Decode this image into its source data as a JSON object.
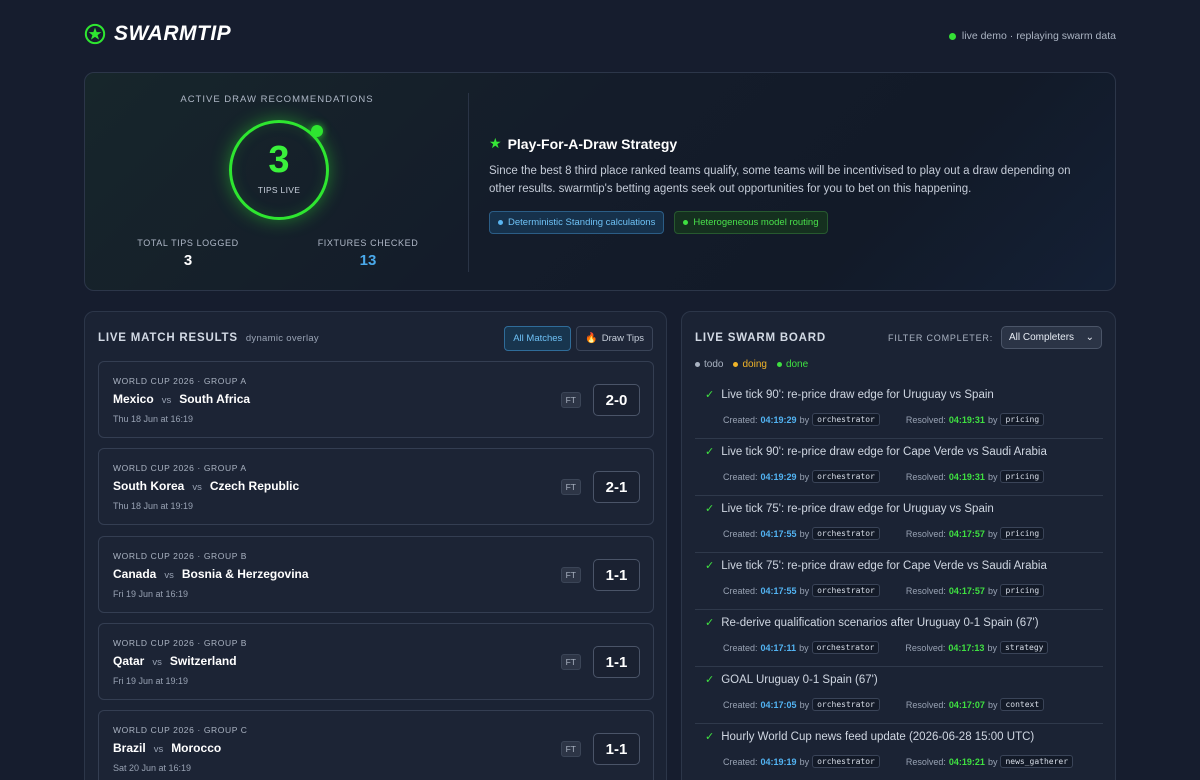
{
  "header": {
    "brand": "SWARMTIP",
    "live_status": "live demo · replaying swarm data"
  },
  "hero": {
    "active_label": "ACTIVE DRAW RECOMMENDATIONS",
    "tips_live_value": "3",
    "tips_live_label": "TIPS LIVE",
    "total_tips_label": "TOTAL TIPS LOGGED",
    "total_tips_value": "3",
    "fixtures_label": "FIXTURES CHECKED",
    "fixtures_value": "13",
    "strategy_title": "Play-For-A-Draw Strategy",
    "strategy_desc": "Since the best 8 third place ranked teams qualify, some teams will be incentivised to play out a draw depending on other results. swarmtip's betting agents seek out opportunities for you to bet on this happening.",
    "chip_1": "Deterministic Standing calculations",
    "chip_2": "Heterogeneous model routing"
  },
  "results": {
    "title": "LIVE MATCH RESULTS",
    "subtitle": "dynamic overlay",
    "tab_all": "All Matches",
    "tab_draw": "Draw Tips",
    "matches": [
      {
        "group": "WORLD CUP 2026 · GROUP A",
        "home": "Mexico",
        "vs": "vs",
        "away": "South Africa",
        "date": "Thu 18 Jun at 16:19",
        "status": "FT",
        "score": "2-0"
      },
      {
        "group": "WORLD CUP 2026 · GROUP A",
        "home": "South Korea",
        "vs": "vs",
        "away": "Czech Republic",
        "date": "Thu 18 Jun at 19:19",
        "status": "FT",
        "score": "2-1"
      },
      {
        "group": "WORLD CUP 2026 · GROUP B",
        "home": "Canada",
        "vs": "vs",
        "away": "Bosnia & Herzegovina",
        "date": "Fri 19 Jun at 16:19",
        "status": "FT",
        "score": "1-1"
      },
      {
        "group": "WORLD CUP 2026 · GROUP B",
        "home": "Qatar",
        "vs": "vs",
        "away": "Switzerland",
        "date": "Fri 19 Jun at 19:19",
        "status": "FT",
        "score": "1-1"
      },
      {
        "group": "WORLD CUP 2026 · GROUP C",
        "home": "Brazil",
        "vs": "vs",
        "away": "Morocco",
        "date": "Sat 20 Jun at 16:19",
        "status": "FT",
        "score": "1-1"
      }
    ]
  },
  "board": {
    "title": "LIVE SWARM BOARD",
    "filter_label": "FILTER COMPLETER:",
    "filter_value": "All Completers",
    "legend_todo": "todo",
    "legend_doing": "doing",
    "legend_done": "done",
    "created_label": "Created:",
    "resolved_label": "Resolved:",
    "by_label": "by",
    "tasks": [
      {
        "title": "Live tick 90': re-price draw edge for Uruguay vs Spain",
        "created": "04:19:29",
        "creator": "orchestrator",
        "resolved": "04:19:31",
        "resolver": "pricing"
      },
      {
        "title": "Live tick 90': re-price draw edge for Cape Verde vs Saudi Arabia",
        "created": "04:19:29",
        "creator": "orchestrator",
        "resolved": "04:19:31",
        "resolver": "pricing"
      },
      {
        "title": "Live tick 75': re-price draw edge for Uruguay vs Spain",
        "created": "04:17:55",
        "creator": "orchestrator",
        "resolved": "04:17:57",
        "resolver": "pricing"
      },
      {
        "title": "Live tick 75': re-price draw edge for Cape Verde vs Saudi Arabia",
        "created": "04:17:55",
        "creator": "orchestrator",
        "resolved": "04:17:57",
        "resolver": "pricing"
      },
      {
        "title": "Re-derive qualification scenarios after Uruguay 0-1 Spain (67')",
        "created": "04:17:11",
        "creator": "orchestrator",
        "resolved": "04:17:13",
        "resolver": "strategy"
      },
      {
        "title": "GOAL Uruguay 0-1 Spain (67')",
        "created": "04:17:05",
        "creator": "orchestrator",
        "resolved": "04:17:07",
        "resolver": "context"
      },
      {
        "title": "Hourly World Cup news feed update (2026-06-28 15:00 UTC)",
        "created": "04:19:19",
        "creator": "orchestrator",
        "resolved": "04:19:21",
        "resolver": "news_gatherer"
      }
    ]
  },
  "colors": {
    "accent_green": "#2ee630",
    "accent_blue": "#4aa9ea",
    "background": "#161d2e"
  }
}
